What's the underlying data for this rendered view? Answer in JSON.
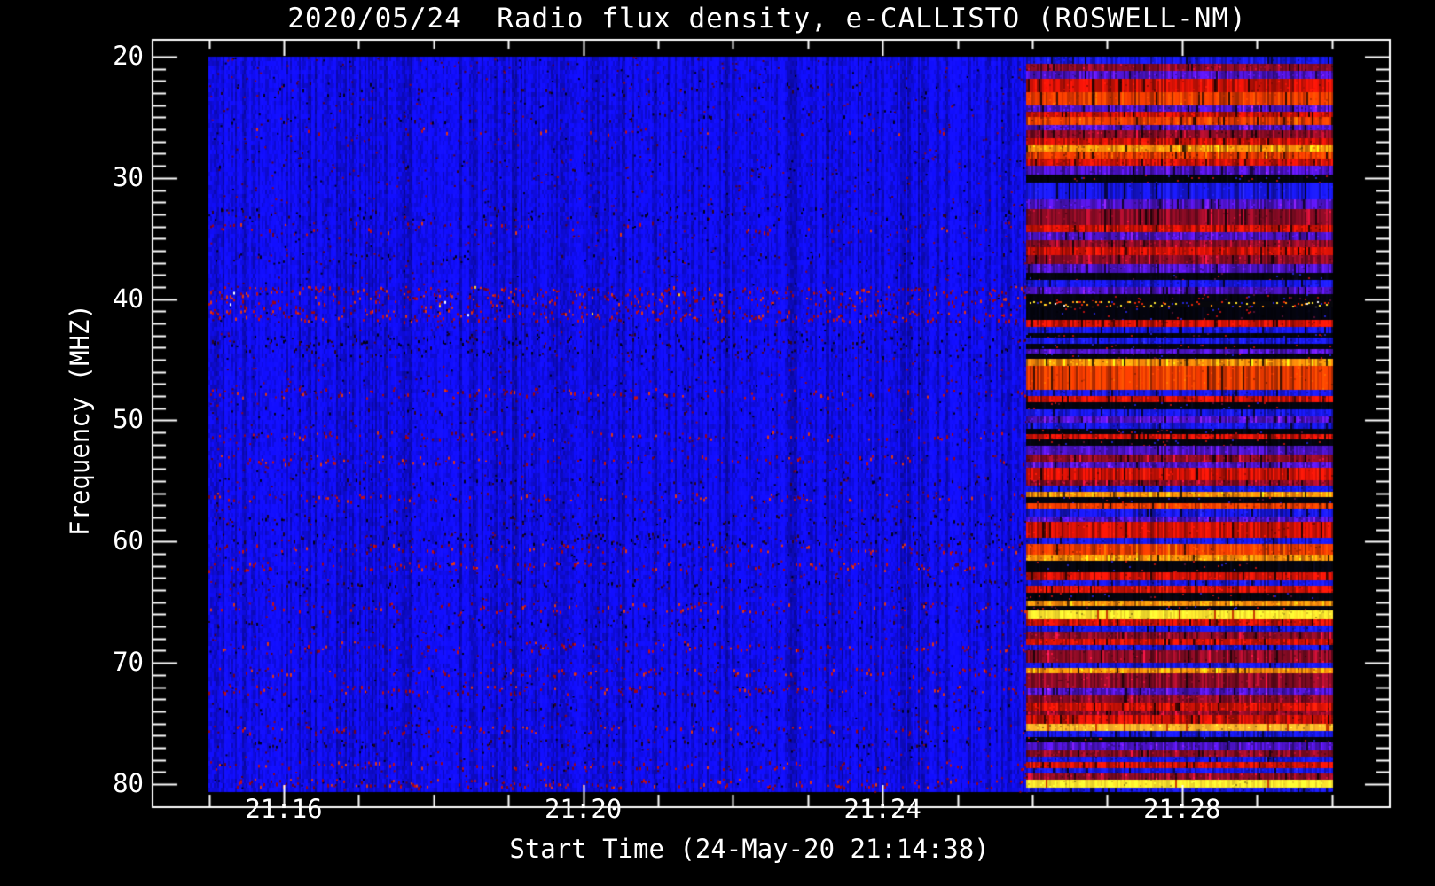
{
  "figure": {
    "title": "2020/05/24  Radio flux density, e-CALLISTO (ROSWELL-NM)"
  },
  "chart_data": {
    "type": "heatmap",
    "subtype": "radio-spectrogram",
    "title": "2020/05/24  Radio flux density, e-CALLISTO (ROSWELL-NM)",
    "xlabel": "Start Time (24-May-20 21:14:38)",
    "ylabel": "Frequency (MHZ)",
    "x_axis": {
      "unit": "time (UT)",
      "start": "21:14:38",
      "end": "21:30",
      "major_ticks": [
        {
          "label": "21:16",
          "minute": 16
        },
        {
          "label": "21:20",
          "minute": 20
        },
        {
          "label": "21:24",
          "minute": 24
        },
        {
          "label": "21:28",
          "minute": 28
        }
      ],
      "minor_tick_minutes": [
        15,
        17,
        18,
        19,
        21,
        22,
        23,
        25,
        26,
        27,
        29,
        30
      ]
    },
    "y_axis": {
      "unit": "MHz",
      "min": 20,
      "max": 80.6,
      "major_ticks": [
        20,
        30,
        40,
        50,
        60,
        70,
        80
      ],
      "minor_step": 1,
      "direction": "increasing-downward"
    },
    "colormap_low_to_high": [
      "#04040e",
      "#1616e6",
      "#870b24",
      "#cc1106",
      "#ff8c0a",
      "#ffe62e",
      "#ffffff"
    ],
    "palette": {
      "B": "#1616e6",
      "P": "#4a12c2",
      "R": "#cc1106",
      "DR": "#870b24",
      "BR": "#ef3a00",
      "O": "#ff8c0a",
      "Y": "#ffe62e",
      "Y2": "#ffb428",
      "K": "#04040e",
      "M": "#07070c"
    },
    "sections": [
      {
        "name": "quiet-background",
        "t_start_min": 15.0,
        "t_end_min": 25.92,
        "description": "mostly quiet blue background with faint vertical striation and narrowband RFI rows; strongest RFI band near 39-41.5 MHz",
        "rfi_rows": [
          [
            22.6,
            0.5,
            0.1,
            "dark"
          ],
          [
            24.9,
            0.5,
            0.08,
            "dark"
          ],
          [
            26.1,
            0.4,
            0.07,
            "red"
          ],
          [
            29.0,
            0.4,
            0.05,
            "dark"
          ],
          [
            32.9,
            0.5,
            0.14,
            "dark"
          ],
          [
            34.1,
            0.5,
            0.16,
            "red"
          ],
          [
            36.6,
            0.4,
            0.08,
            "dark"
          ],
          [
            39.3,
            0.4,
            0.45,
            "red"
          ],
          [
            40.2,
            0.45,
            0.38,
            "red"
          ],
          [
            41.3,
            0.5,
            0.5,
            "red"
          ],
          [
            43.3,
            0.5,
            0.3,
            "dark"
          ],
          [
            44.3,
            0.4,
            0.18,
            "dark"
          ],
          [
            47.7,
            0.4,
            0.22,
            "red"
          ],
          [
            49.1,
            0.3,
            0.1,
            "dark"
          ],
          [
            51.2,
            0.35,
            0.22,
            "red"
          ],
          [
            53.2,
            0.35,
            0.22,
            "red"
          ],
          [
            54.9,
            0.3,
            0.12,
            "dark"
          ],
          [
            56.3,
            0.35,
            0.18,
            "red"
          ],
          [
            58.1,
            0.4,
            0.15,
            "dark"
          ],
          [
            59.7,
            0.45,
            0.25,
            "dark"
          ],
          [
            60.5,
            0.35,
            0.22,
            "red"
          ],
          [
            62.0,
            0.35,
            0.25,
            "red"
          ],
          [
            63.4,
            0.3,
            0.15,
            "dark"
          ],
          [
            65.4,
            0.4,
            0.28,
            "red"
          ],
          [
            66.7,
            0.3,
            0.12,
            "dark"
          ],
          [
            68.6,
            0.4,
            0.25,
            "red"
          ],
          [
            70.7,
            0.35,
            0.22,
            "red"
          ],
          [
            72.2,
            0.35,
            0.25,
            "red"
          ],
          [
            73.6,
            0.3,
            0.12,
            "dark"
          ],
          [
            75.4,
            0.35,
            0.22,
            "red"
          ],
          [
            76.6,
            0.3,
            0.14,
            "dark"
          ],
          [
            78.4,
            0.3,
            0.18,
            "red"
          ],
          [
            79.9,
            0.35,
            0.3,
            "red"
          ]
        ]
      },
      {
        "name": "broadband-interference",
        "t_start_min": 25.92,
        "t_end_min": 30.0,
        "description": "strong horizontal interference bands (red/orange/yellow/black) over full frequency range; bright yellow bands near 66, 75 and 80 MHz; black notches near 41-44, 48.5-52 and 61.6-65 MHz",
        "bands": [
          [
            20.0,
            20.6,
            "B"
          ],
          [
            20.6,
            21.2,
            "DR"
          ],
          [
            21.2,
            21.8,
            "P"
          ],
          [
            21.8,
            22.9,
            "R"
          ],
          [
            22.9,
            24.0,
            "BR"
          ],
          [
            24.0,
            24.5,
            "P"
          ],
          [
            24.5,
            25.0,
            "R"
          ],
          [
            25.0,
            25.6,
            "BR"
          ],
          [
            25.6,
            26.1,
            "P"
          ],
          [
            26.1,
            26.7,
            "DR"
          ],
          [
            26.7,
            27.3,
            "R"
          ],
          [
            27.3,
            27.8,
            "O"
          ],
          [
            27.8,
            28.4,
            "BR"
          ],
          [
            28.4,
            29.0,
            "R"
          ],
          [
            29.0,
            29.7,
            "P"
          ],
          [
            29.7,
            30.4,
            "K"
          ],
          [
            30.4,
            31.8,
            "B"
          ],
          [
            31.8,
            32.6,
            "P"
          ],
          [
            32.6,
            33.9,
            "DR"
          ],
          [
            33.9,
            34.5,
            "R"
          ],
          [
            34.5,
            35.1,
            "P"
          ],
          [
            35.1,
            35.7,
            "DR"
          ],
          [
            35.7,
            36.4,
            "R"
          ],
          [
            36.4,
            37.1,
            "DR"
          ],
          [
            37.1,
            37.8,
            "P"
          ],
          [
            37.8,
            38.4,
            "K"
          ],
          [
            38.4,
            39.0,
            "B"
          ],
          [
            39.0,
            39.6,
            "P"
          ],
          [
            39.6,
            40.2,
            "K"
          ],
          [
            40.2,
            40.7,
            "M"
          ],
          [
            40.7,
            41.7,
            "K"
          ],
          [
            41.7,
            42.3,
            "R"
          ],
          [
            42.3,
            42.8,
            "B"
          ],
          [
            42.8,
            43.2,
            "K"
          ],
          [
            43.2,
            43.7,
            "B"
          ],
          [
            43.7,
            44.1,
            "K"
          ],
          [
            44.1,
            44.5,
            "P"
          ],
          [
            44.5,
            44.9,
            "K"
          ],
          [
            44.9,
            45.5,
            "O"
          ],
          [
            45.5,
            47.5,
            "BR"
          ],
          [
            47.5,
            48.0,
            "B"
          ],
          [
            48.0,
            48.5,
            "R"
          ],
          [
            48.5,
            49.1,
            "K"
          ],
          [
            49.1,
            49.7,
            "B"
          ],
          [
            49.7,
            50.2,
            "P"
          ],
          [
            50.2,
            50.7,
            "B"
          ],
          [
            50.7,
            51.1,
            "K"
          ],
          [
            51.1,
            51.6,
            "R"
          ],
          [
            51.6,
            52.1,
            "K"
          ],
          [
            52.1,
            52.8,
            "P"
          ],
          [
            52.8,
            53.5,
            "DR"
          ],
          [
            53.5,
            53.9,
            "P"
          ],
          [
            53.9,
            54.9,
            "R"
          ],
          [
            54.9,
            55.4,
            "DR"
          ],
          [
            55.4,
            55.9,
            "B"
          ],
          [
            55.9,
            56.3,
            "O"
          ],
          [
            56.3,
            56.8,
            "K"
          ],
          [
            56.8,
            57.3,
            "BR"
          ],
          [
            57.3,
            57.9,
            "B"
          ],
          [
            57.9,
            58.4,
            "P"
          ],
          [
            58.4,
            59.7,
            "R"
          ],
          [
            59.7,
            60.2,
            "B"
          ],
          [
            60.2,
            61.1,
            "BR"
          ],
          [
            61.1,
            61.6,
            "O"
          ],
          [
            61.6,
            62.5,
            "K"
          ],
          [
            62.5,
            63.2,
            "R"
          ],
          [
            63.2,
            63.6,
            "B"
          ],
          [
            63.6,
            64.2,
            "R"
          ],
          [
            64.2,
            64.9,
            "K"
          ],
          [
            64.9,
            65.3,
            "O"
          ],
          [
            65.3,
            65.7,
            "K"
          ],
          [
            65.7,
            66.4,
            "Y"
          ],
          [
            66.4,
            66.9,
            "R"
          ],
          [
            66.9,
            67.4,
            "B"
          ],
          [
            67.4,
            68.0,
            "DR"
          ],
          [
            68.0,
            68.5,
            "R"
          ],
          [
            68.5,
            69.0,
            "B"
          ],
          [
            69.0,
            70.0,
            "DR"
          ],
          [
            70.0,
            70.4,
            "B"
          ],
          [
            70.4,
            70.9,
            "O"
          ],
          [
            70.9,
            72.0,
            "DR"
          ],
          [
            72.0,
            72.6,
            "P"
          ],
          [
            72.6,
            73.3,
            "DR"
          ],
          [
            73.3,
            73.9,
            "R"
          ],
          [
            73.9,
            74.3,
            "DR"
          ],
          [
            74.3,
            75.0,
            "R"
          ],
          [
            75.0,
            75.6,
            "Y2"
          ],
          [
            75.6,
            76.1,
            "B"
          ],
          [
            76.1,
            76.6,
            "K"
          ],
          [
            76.6,
            77.2,
            "P"
          ],
          [
            77.2,
            77.7,
            "DR"
          ],
          [
            77.7,
            78.2,
            "B"
          ],
          [
            78.2,
            78.7,
            "R"
          ],
          [
            78.7,
            79.1,
            "B"
          ],
          [
            79.1,
            79.6,
            "DR"
          ],
          [
            79.6,
            80.3,
            "Y"
          ],
          [
            80.3,
            80.6,
            "B"
          ]
        ]
      }
    ]
  }
}
